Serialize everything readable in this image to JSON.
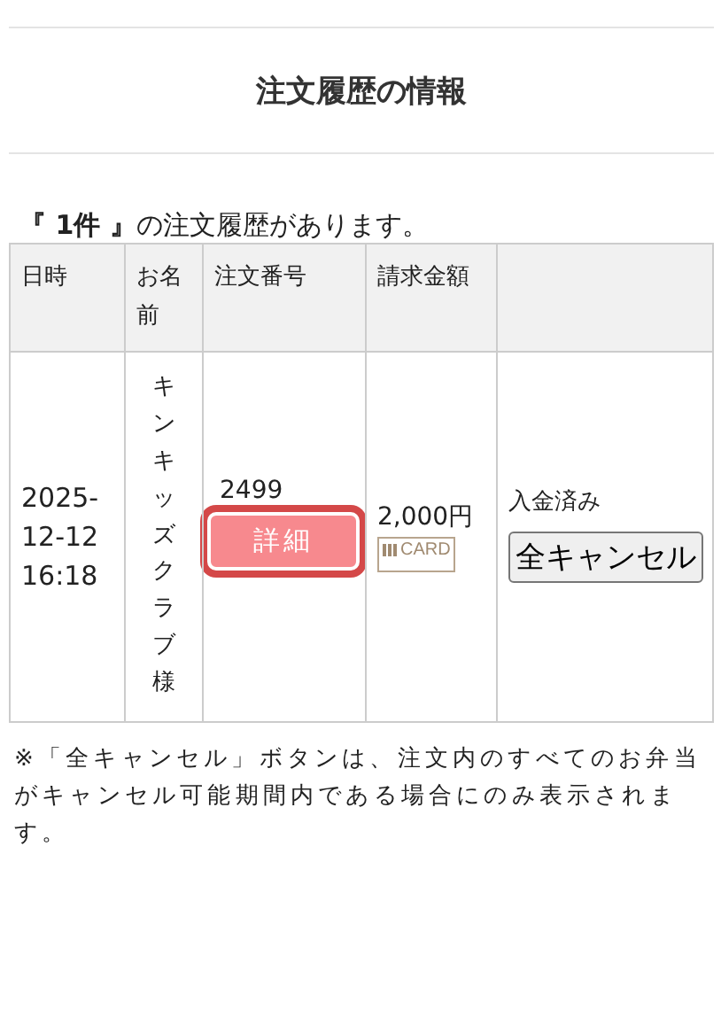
{
  "title": "注文履歴の情報",
  "summary": "**『 1件 』**の注文履歴があります。",
  "table": {
    "columns": [
      "日時",
      "お名前",
      "注文番号",
      "請求金額",
      ""
    ],
    "rows": [
      {
        "datetime": "2025-12-12 16:18",
        "name": "キンキッズクラブ様",
        "order_no": "2499",
        "detail_button": "詳細",
        "detail_focused": true,
        "amount": "2,000円",
        "payment": "CARD",
        "status": "入金済み",
        "cancel_button": "全キャンセル"
      }
    ]
  },
  "note": "※「全キャンセル」ボタンは、注文内のすべてのお弁当がキャンセル可能期間内である場合にのみ表示されます。"
}
